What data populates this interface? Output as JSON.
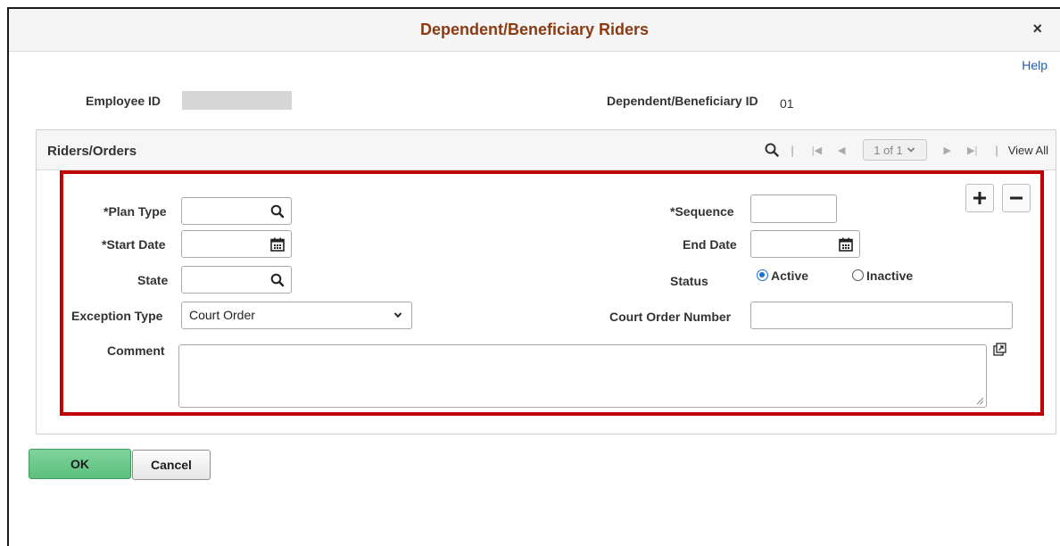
{
  "dialog": {
    "title": "Dependent/Beneficiary Riders",
    "close_symbol": "×",
    "help_label": "Help"
  },
  "header": {
    "employee_id_label": "Employee ID",
    "employee_id_value": "",
    "dependent_id_label": "Dependent/Beneficiary ID",
    "dependent_id_value": "01"
  },
  "group": {
    "title": "Riders/Orders",
    "pager_text": "1 of 1",
    "view_all_label": "View All"
  },
  "form": {
    "plan_type_label": "*Plan Type",
    "plan_type_value": "",
    "start_date_label": "*Start Date",
    "start_date_value": "",
    "state_label": "State",
    "state_value": "",
    "exception_type_label": "Exception Type",
    "exception_type_value": "Court Order",
    "comment_label": "Comment",
    "comment_value": "",
    "sequence_label": "*Sequence",
    "sequence_value": "",
    "end_date_label": "End Date",
    "end_date_value": "",
    "status_label": "Status",
    "status_options": [
      "Active",
      "Inactive"
    ],
    "status_selected": "Active",
    "court_order_number_label": "Court Order Number",
    "court_order_number_value": ""
  },
  "buttons": {
    "ok_label": "OK",
    "cancel_label": "Cancel"
  },
  "colors": {
    "title": "#8b3a12",
    "highlight": "#c00000",
    "link": "#1f5fa8",
    "radio_selected": "#1a6fd6",
    "ok_button": "#6cc98b"
  },
  "icons": [
    "close-icon",
    "search-icon",
    "calendar-icon",
    "chevron-down-icon",
    "first-page-icon",
    "previous-page-icon",
    "next-page-icon",
    "last-page-icon",
    "add-icon",
    "delete-icon",
    "expand-comment-icon",
    "resize-handle-icon"
  ]
}
